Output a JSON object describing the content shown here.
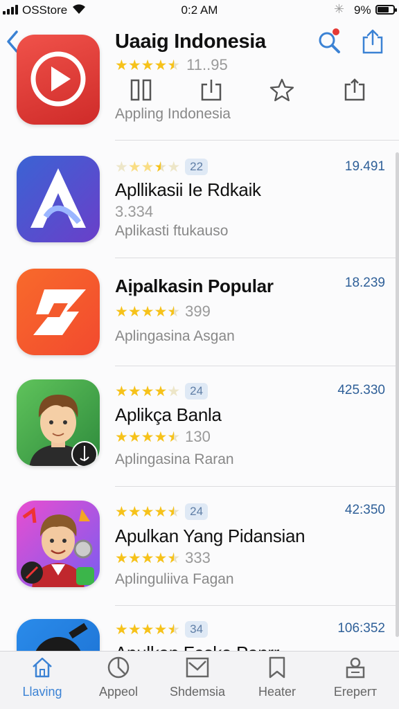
{
  "status": {
    "carrier": "OSStore",
    "time": "0:2 AM",
    "battery": "9%"
  },
  "header": {
    "title": "Uaaig Indonesia",
    "rating_count": "11..95",
    "subtitle": "Appling Indonesia",
    "icons": [
      "back-icon",
      "search-icon",
      "share-icon",
      "pause-icon",
      "share-icon",
      "star-icon",
      "share-icon"
    ],
    "accent": "#3b82d4",
    "notification_dot": "#e53935"
  },
  "apps": [
    {
      "name": "Apllikasii Ie Rdkaik",
      "badge": "22",
      "price": "19.491",
      "count": "3.334",
      "subtitle": "Aplikasti ftukauso",
      "stars": 3.5
    },
    {
      "name": "Aịpalkasin Popular",
      "price": "18.239",
      "count": "399",
      "subtitle": "Aplingasina Asgan",
      "stars": 4.5
    },
    {
      "name": "Aplikça Banla",
      "badge": "24",
      "price": "425.330",
      "count": "130",
      "subtitle": "Aplingasina Raran",
      "stars": 4
    },
    {
      "name": "Apulkan Yang Pidansian",
      "badge": "24",
      "price": "42:350",
      "count": "333",
      "subtitle": "Aplinguliiva Fagan",
      "stars": 4.5
    },
    {
      "name": "Apulkan Fasko Panrr",
      "badge": "34",
      "price": "106:352",
      "stars": 4.5
    }
  ],
  "tabbar": {
    "tabs": [
      {
        "label": "Llaving",
        "icon": "home-icon",
        "active": true
      },
      {
        "label": "Appeol",
        "icon": "pie-chart-icon",
        "active": false
      },
      {
        "label": "Shdemsia",
        "icon": "inbox-icon",
        "active": false
      },
      {
        "label": "Heater",
        "icon": "bookmark-icon",
        "active": false
      },
      {
        "label": "Ereperт",
        "icon": "profile-icon",
        "active": false
      }
    ]
  }
}
